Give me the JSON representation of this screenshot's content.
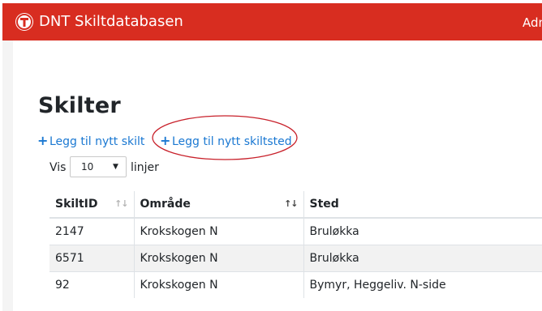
{
  "header": {
    "brand": "DNT Skiltdatabasen",
    "user_menu": "Adm"
  },
  "page": {
    "title": "Skilter"
  },
  "actions": {
    "add_sign": "Legg til nytt skilt",
    "add_sign_location": "Legg til nytt skiltsted"
  },
  "length_menu": {
    "prefix": "Vis",
    "selected": "10",
    "suffix": "linjer"
  },
  "table": {
    "columns": [
      "SkiltID",
      "Område",
      "Sted"
    ],
    "rows": [
      [
        "2147",
        "Krokskogen N",
        "Bruløkka"
      ],
      [
        "6571",
        "Krokskogen N",
        "Bruløkka"
      ],
      [
        "92",
        "Krokskogen N",
        "Bymyr, Heggeliv. N-side"
      ]
    ]
  },
  "colors": {
    "navbar": "#d82d20",
    "link": "#1a78d2",
    "annotation": "#c8202a"
  },
  "icons": [
    "dnt-logo-icon",
    "plus-icon",
    "chevron-down-icon",
    "sort-icon"
  ]
}
